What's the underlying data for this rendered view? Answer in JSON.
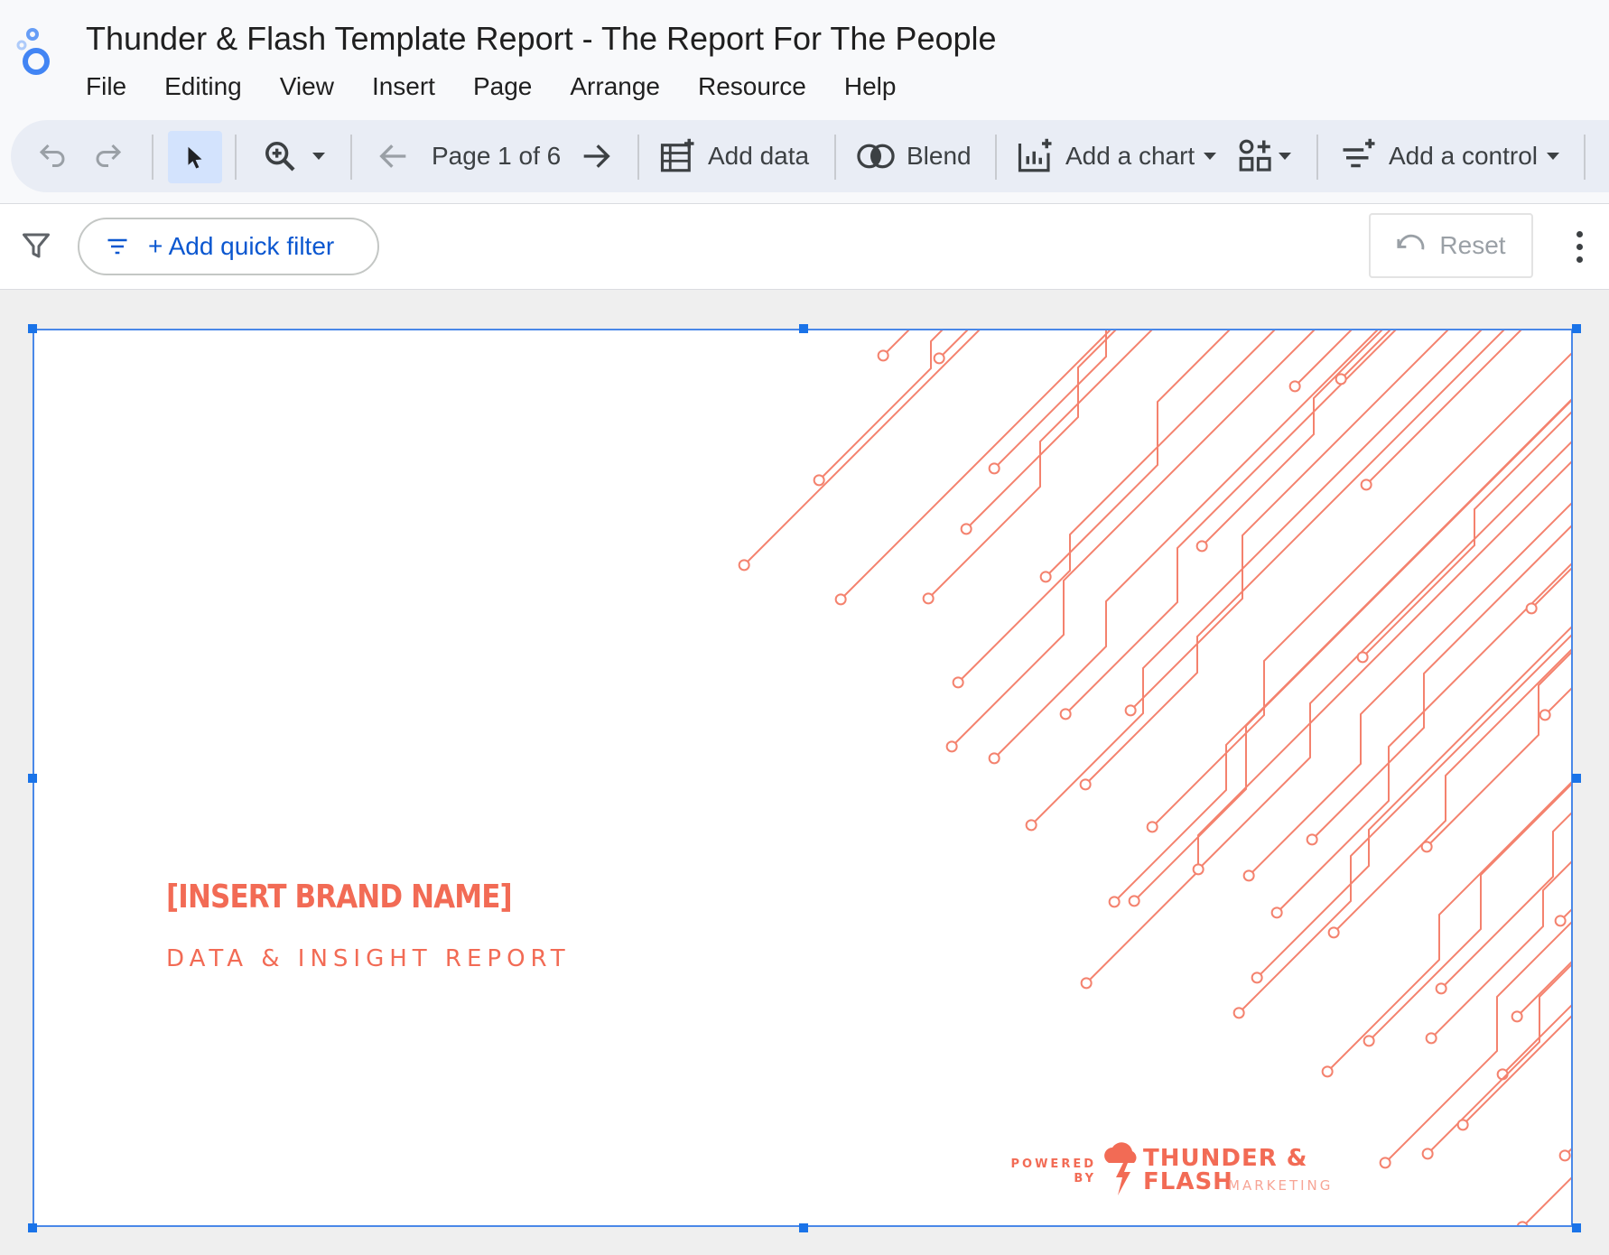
{
  "app": {
    "title": "Thunder & Flash Template Report - The Report For The People",
    "logo_icon": "looker-studio-logo-icon",
    "accent": "#1a73e8"
  },
  "menu": [
    "File",
    "Editing",
    "View",
    "Insert",
    "Page",
    "Arrange",
    "Resource",
    "Help"
  ],
  "toolbar": {
    "undo_icon": "undo-icon",
    "redo_icon": "redo-icon",
    "select_icon": "cursor-icon",
    "zoom_icon": "zoom-in-icon",
    "page_indicator": "Page 1 of 6",
    "add_data": "Add data",
    "blend": "Blend",
    "add_chart": "Add a chart",
    "add_control": "Add a control"
  },
  "filterbar": {
    "quick_filter": "+ Add quick filter",
    "reset": "Reset"
  },
  "report": {
    "brand_name": "[INSERT BRAND NAME]",
    "subtitle": "DATA & INSIGHT REPORT",
    "powered_by_line1": "POWERED",
    "powered_by_line2": "BY",
    "logo_line1": "THUNDER &",
    "logo_line2": "FLASH",
    "logo_tagline": "MARKETING",
    "brand_color": "#f26b55"
  }
}
